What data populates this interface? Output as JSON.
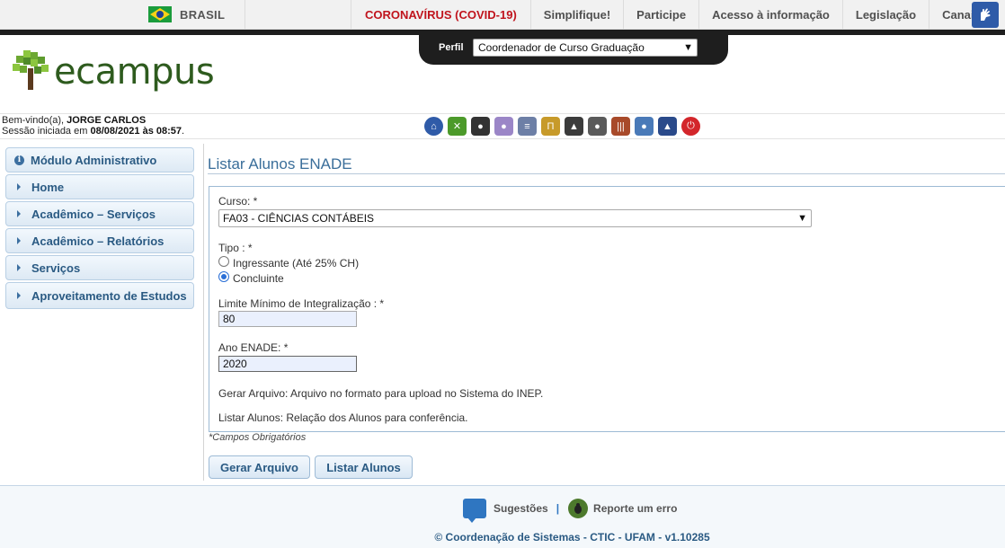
{
  "govbar": {
    "country": "BRASIL",
    "links": [
      "CORONAVÍRUS (COVID-19)",
      "Simplifique!",
      "Participe",
      "Acesso à informação",
      "Legislação",
      "Canais"
    ],
    "covid_color": "#c0141d",
    "accessibility_icon": "hand-sign-icon"
  },
  "perfil": {
    "label": "Perfil",
    "selected": "Coordenador de Curso Graduação"
  },
  "logo": {
    "text": "ecampus"
  },
  "welcome": {
    "greeting_prefix": "Bem-vindo(a),",
    "user": "JORGE CARLOS",
    "session_prefix": "Sessão iniciada em",
    "session_date": "08/08/2021",
    "session_mid": "às",
    "session_time": "08:57",
    "session_suffix": "."
  },
  "toolbar_icons": [
    "home-icon",
    "tools-icon",
    "user-icon",
    "person-icon",
    "document-icon",
    "building-icon",
    "graduate-icon",
    "teacher-icon",
    "books-icon",
    "people-icon",
    "diploma-icon",
    "power-icon"
  ],
  "sidebar": {
    "items": [
      {
        "label": "Módulo Administrativo",
        "icon": "info-icon"
      },
      {
        "label": "Home",
        "icon": "arrow-icon"
      },
      {
        "label": "Acadêmico – Serviços",
        "icon": "arrow-icon"
      },
      {
        "label": "Acadêmico – Relatórios",
        "icon": "arrow-icon"
      },
      {
        "label": "Serviços",
        "icon": "arrow-icon"
      },
      {
        "label": "Aproveitamento de Estudos",
        "icon": "arrow-icon"
      }
    ]
  },
  "main": {
    "title": "Listar Alunos ENADE",
    "curso_label": "Curso: *",
    "curso_value": "FA03 - CIÊNCIAS CONTÁBEIS",
    "tipo_label": "Tipo : *",
    "tipo_options": [
      "Ingressante (Até 25% CH)",
      "Concluinte"
    ],
    "tipo_selected": "Concluinte",
    "limite_label": "Limite Mínimo de Integralização : *",
    "limite_value": "80",
    "ano_label": "Ano ENADE: *",
    "ano_value": "2020",
    "help_gerar": "Gerar Arquivo: Arquivo no formato para upload no Sistema do INEP.",
    "help_listar": "Listar Alunos: Relação dos Alunos para conferência.",
    "required_note": "*Campos Obrigatórios",
    "btn_gerar": "Gerar Arquivo",
    "btn_listar": "Listar Alunos"
  },
  "footer": {
    "sugestoes": "Sugestões",
    "separator": "|",
    "reporte": "Reporte um erro",
    "copyright": "© Coordenação de Sistemas - CTIC - UFAM - v1.10285"
  }
}
